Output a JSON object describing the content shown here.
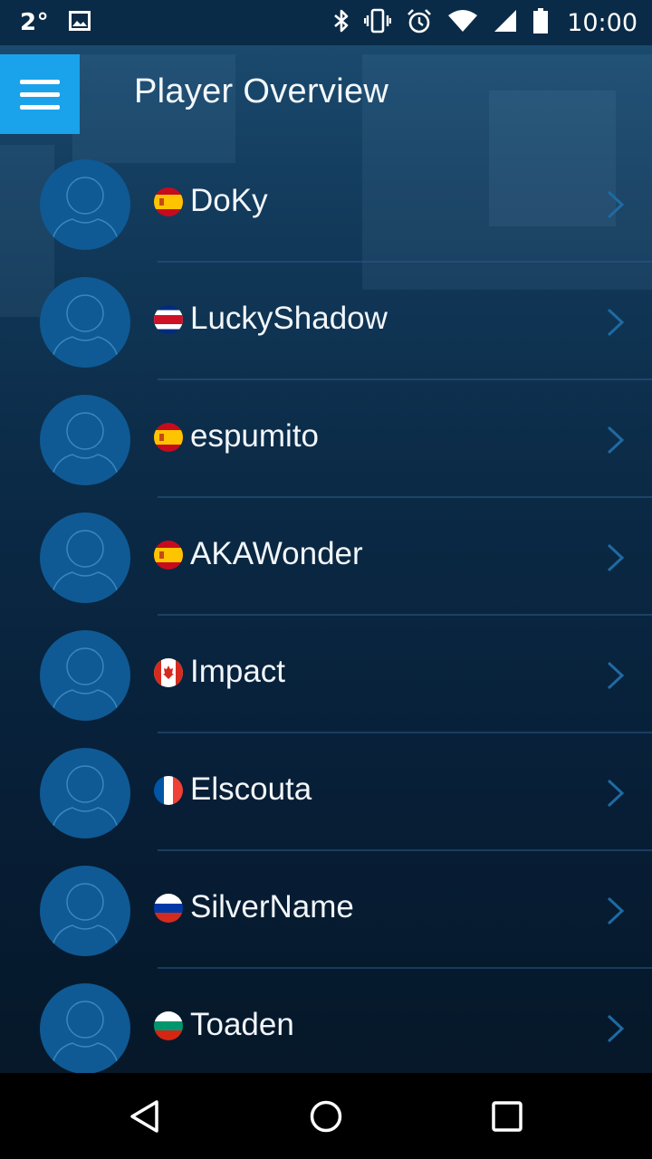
{
  "status_bar": {
    "temperature": "2°",
    "time": "10:00",
    "icons": [
      "image-icon",
      "bluetooth-icon",
      "vibrate-icon",
      "alarm-icon",
      "wifi-icon",
      "signal-icon",
      "battery-icon"
    ]
  },
  "app_bar": {
    "title": "Player Overview",
    "menu_icon": "hamburger-menu-icon"
  },
  "players": [
    {
      "name": "DoKy",
      "flag": "spain"
    },
    {
      "name": "LuckyShadow",
      "flag": "costa-rica"
    },
    {
      "name": "espumito",
      "flag": "spain"
    },
    {
      "name": "AKAWonder",
      "flag": "spain"
    },
    {
      "name": "Impact",
      "flag": "canada"
    },
    {
      "name": "Elscouta",
      "flag": "france"
    },
    {
      "name": "SilverName",
      "flag": "russia"
    },
    {
      "name": "Toaden",
      "flag": "bulgaria"
    }
  ],
  "nav_bar": {
    "back": "back-icon",
    "home": "home-icon",
    "recents": "recents-icon"
  },
  "colors": {
    "accent": "#1aa3ea",
    "avatar": "#0f5a94",
    "background": "#0b2a46",
    "chevron": "#1f6aa3"
  }
}
